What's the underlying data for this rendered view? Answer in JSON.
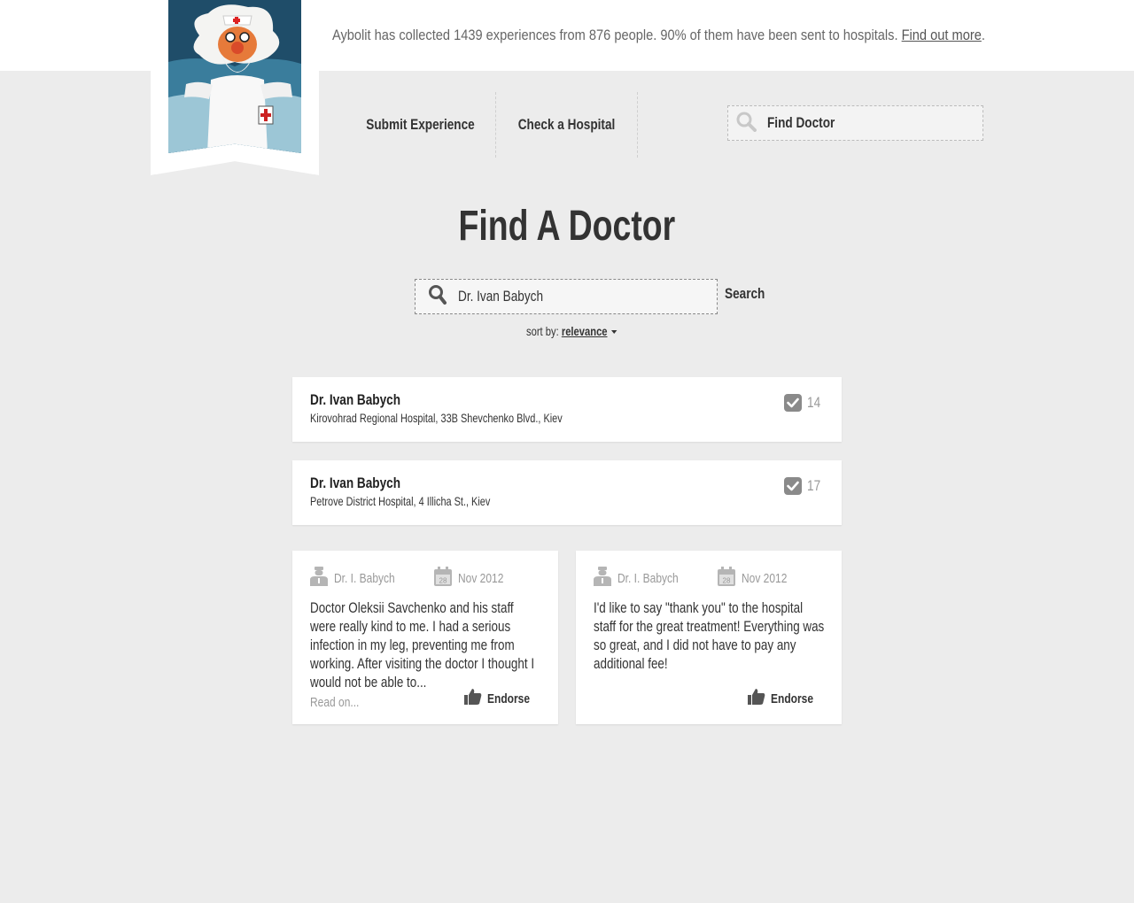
{
  "header": {
    "message": "Aybolit has collected 1439 experiences from 876 people. 90% of them have been sent to hospitals. ",
    "message_link": "Find out more",
    "message_end": "."
  },
  "nav": {
    "items": [
      {
        "label": "Submit Experience"
      },
      {
        "label": "Check a Hospital"
      }
    ],
    "search_label": "Find Doctor"
  },
  "page": {
    "title": "Find A Doctor",
    "search_value": "Dr. Ivan Babych",
    "search_button": "Search",
    "sort_prefix": "sort by:",
    "sort_value": "relevance"
  },
  "results": [
    {
      "name": "Dr. Ivan Babych",
      "address": "Kirovohrad Regional Hospital, 33B Shevchenko Blvd., Kiev",
      "count": "14"
    },
    {
      "name": "Dr. Ivan Babych",
      "address": "Petrove District Hospital, 4 Illicha St., Kiev",
      "count": "17"
    }
  ],
  "experiences": [
    {
      "doctor": "Dr. I. Babych",
      "calendar_day": "28",
      "date": "Nov 2012",
      "text": "Doctor Oleksii Savchenko and his staff were really kind to me. I had a serious infection in my leg, preventing me from working. After visiting the doctor I thought I would not be able to...",
      "read_on": "Read on...",
      "endorse": "Endorse"
    },
    {
      "doctor": "Dr. I. Babych",
      "calendar_day": "28",
      "date": "Nov 2012",
      "text": "I'd like to say \"thank you\" to the hospital staff for the great treatment! Everything was so great, and I did not have to pay any additional fee!",
      "endorse": "Endorse"
    }
  ],
  "icons": {
    "search": "search-icon",
    "check": "check-icon",
    "doctor": "doctor-icon",
    "calendar": "calendar-icon",
    "thumbs_up": "thumbs-up-icon",
    "logo": "aybolit-logo"
  }
}
